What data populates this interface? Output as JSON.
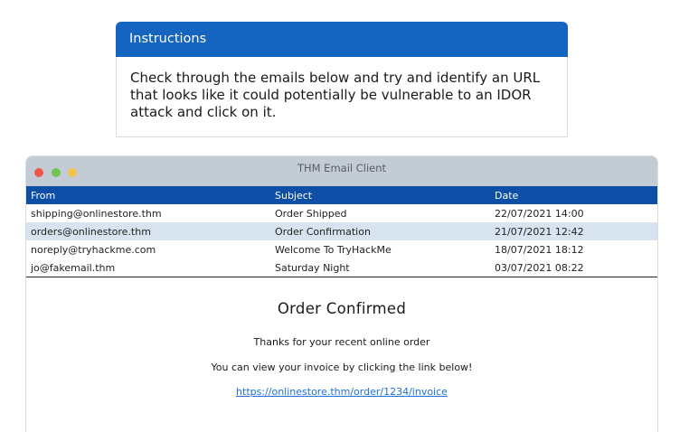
{
  "instructions": {
    "title": "Instructions",
    "text": "Check through the emails below and try and identify an URL that looks like it could potentially be vulnerable to an IDOR attack and click on it."
  },
  "window": {
    "title": "THM Email Client"
  },
  "table": {
    "headers": {
      "from": "From",
      "subject": "Subject",
      "date": "Date"
    },
    "rows": [
      {
        "from": "shipping@onlinestore.thm",
        "subject": "Order Shipped",
        "date": "22/07/2021 14:00"
      },
      {
        "from": "orders@onlinestore.thm",
        "subject": "Order Confirmation",
        "date": "21/07/2021 12:42"
      },
      {
        "from": "noreply@tryhackme.com",
        "subject": "Welcome To TryHackMe",
        "date": "18/07/2021 18:12"
      },
      {
        "from": "jo@fakemail.thm",
        "subject": "Saturday Night",
        "date": "03/07/2021 08:22"
      }
    ]
  },
  "email": {
    "heading": "Order Confirmed",
    "line1": "Thanks for your recent online order",
    "line2": "You can view your invoice by clicking the link below!",
    "link": "https://onlinestore.thm/order/1234/invoice"
  },
  "colors": {
    "instructions_header": "#1565c0",
    "table_header": "#0d4ea6",
    "selected_row": "#d7e4f0",
    "titlebar": "#c3ccd5",
    "link": "#1e6fd9"
  }
}
